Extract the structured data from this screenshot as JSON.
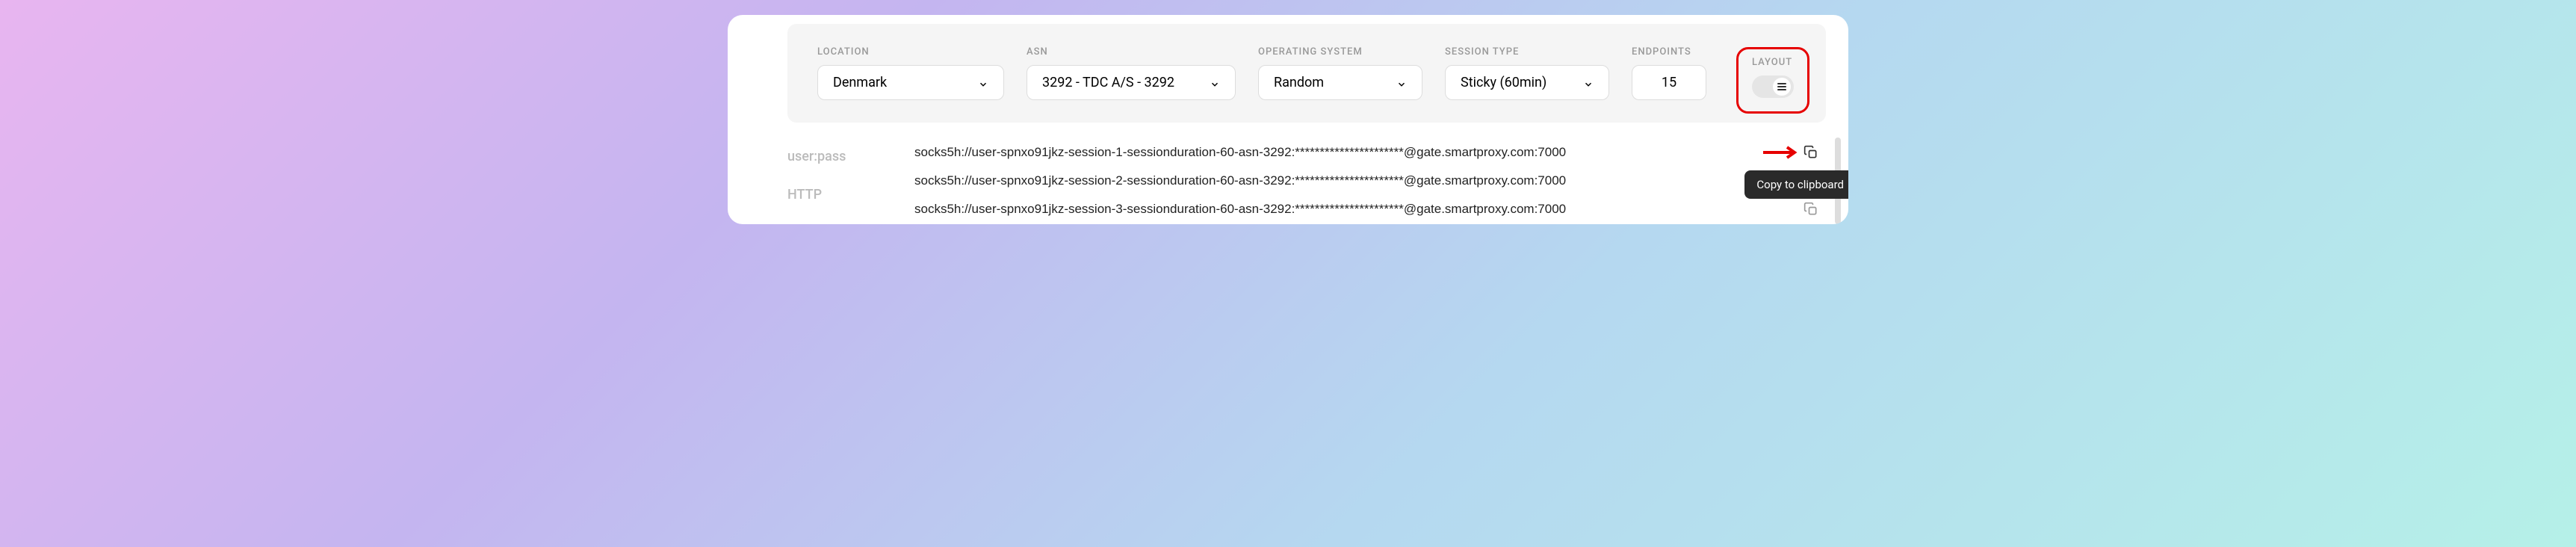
{
  "filters": {
    "location": {
      "label": "LOCATION",
      "value": "Denmark"
    },
    "asn": {
      "label": "ASN",
      "value": "3292 - TDC A/S - 3292"
    },
    "os": {
      "label": "OPERATING SYSTEM",
      "value": "Random"
    },
    "session": {
      "label": "SESSION TYPE",
      "value": "Sticky (60min)"
    },
    "endpoints": {
      "label": "ENDPOINTS",
      "value": "15"
    },
    "layout": {
      "label": "LAYOUT"
    }
  },
  "sidebar": {
    "userpass": "user:pass",
    "http": "HTTP"
  },
  "endpoints": [
    "socks5h://user-spnxo91jkz-session-1-sessionduration-60-asn-3292:**********************@gate.smartproxy.com:7000",
    "socks5h://user-spnxo91jkz-session-2-sessionduration-60-asn-3292:**********************@gate.smartproxy.com:7000",
    "socks5h://user-spnxo91jkz-session-3-sessionduration-60-asn-3292:**********************@gate.smartproxy.com:7000"
  ],
  "tooltip": "Copy to clipboard"
}
